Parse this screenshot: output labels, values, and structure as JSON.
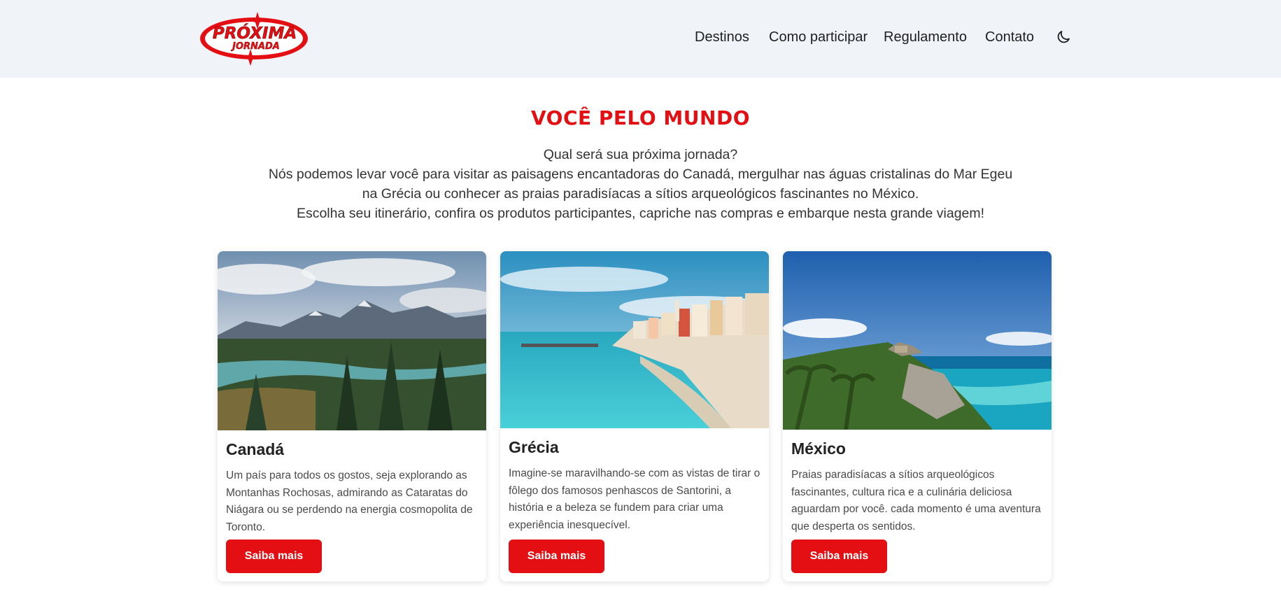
{
  "header": {
    "logo": {
      "line1": "PRÓXIMA",
      "line2": "JORNADA"
    },
    "nav": [
      {
        "label": "Destinos"
      },
      {
        "label": "Como participar"
      },
      {
        "label": "Regulamento"
      },
      {
        "label": "Contato"
      }
    ],
    "theme_toggle_icon": "moon-icon"
  },
  "hero": {
    "title": "VOCÊ PELO MUNDO",
    "lines": [
      "Qual será sua próxima jornada?",
      "Nós podemos levar você para visitar as paisagens encantadoras do Canadá, mergulhar nas águas cristalinas do Mar Egeu",
      "na Grécia ou conhecer as praias paradisíacas a sítios arqueológicos fascinantes no México.",
      "Escolha seu itinerário, confira os produtos participantes, capriche nas compras e embarque nesta grande viagem!"
    ]
  },
  "cards": [
    {
      "title": "Canadá",
      "text_lines": [
        "Um país para todos os gostos, seja explorando as",
        "Montanhas Rochosas, admirando as Cataratas do",
        "Niágara ou se perdendo na energia cosmopolita de",
        "Toronto."
      ],
      "button": "Saiba mais"
    },
    {
      "title": "Grécia",
      "text_lines": [
        "Imagine-se maravilhando-se com as vistas de tirar o",
        "fôlego dos famosos penhascos de Santorini, a",
        "história e a beleza se fundem para criar uma",
        "experiência inesquecível."
      ],
      "button": "Saiba mais"
    },
    {
      "title": "México",
      "text_lines": [
        "Praias paradisíacas a sítios arqueológicos",
        "fascinantes, cultura rica e a culinária deliciosa",
        "aguardam por você. cada momento é uma aventura",
        "que desperta os sentidos."
      ],
      "button": "Saiba mais"
    }
  ],
  "colors": {
    "accent": "#e30f13",
    "header_bg": "#f0f3f8"
  }
}
